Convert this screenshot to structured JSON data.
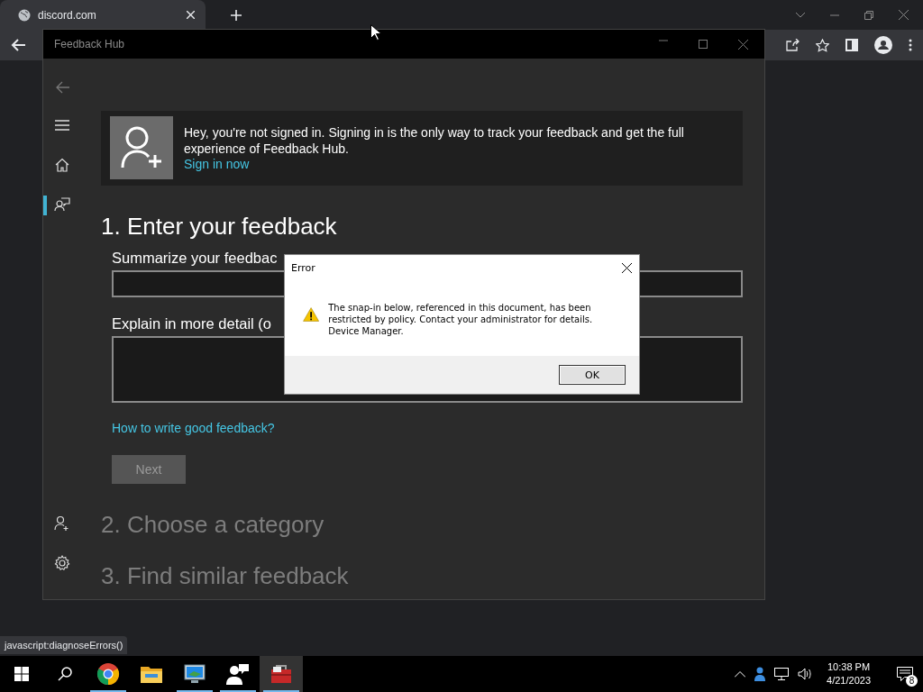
{
  "browser": {
    "tab_title": "discord.com",
    "status_url": "javascript:diagnoseErrors()"
  },
  "feedback_hub": {
    "title": "Feedback Hub",
    "nav_top": [
      {
        "kind": "menu",
        "selected": false
      },
      {
        "kind": "home",
        "selected": false
      },
      {
        "kind": "feedback",
        "selected": true
      }
    ],
    "nav_bottom": [
      {
        "kind": "add-user",
        "selected": false
      },
      {
        "kind": "settings",
        "selected": false
      }
    ],
    "banner": {
      "message": "Hey, you're not signed in. Signing in is the only way to track your feedback and get the full experience of Feedback Hub.",
      "link": "Sign in now"
    },
    "step_1": "1. Enter your feedback",
    "summary_label": "Summarize your feedbac",
    "detail_label": "Explain in more detail (o",
    "help_link": "How to write good feedback?",
    "next_button": {
      "label": "Next",
      "disabled": true
    },
    "step_2": "2. Choose a category",
    "step_3": "3. Find similar feedback"
  },
  "dialog": {
    "title": "Error",
    "message": "The snap-in below, referenced in this document, has been restricted by policy. Contact your administrator for details.\nDevice Manager.",
    "ok": "OK"
  },
  "taskbar": {
    "apps": [
      {
        "kind": "chrome",
        "running": true,
        "selected": false
      },
      {
        "kind": "folder",
        "running": false,
        "selected": false
      },
      {
        "kind": "monitor",
        "running": true,
        "selected": false
      },
      {
        "kind": "people",
        "running": true,
        "selected": false
      },
      {
        "kind": "toolbox",
        "running": true,
        "selected": true
      }
    ],
    "time": "10:38 PM",
    "date": "4/21/2023",
    "notification_count": "8"
  }
}
